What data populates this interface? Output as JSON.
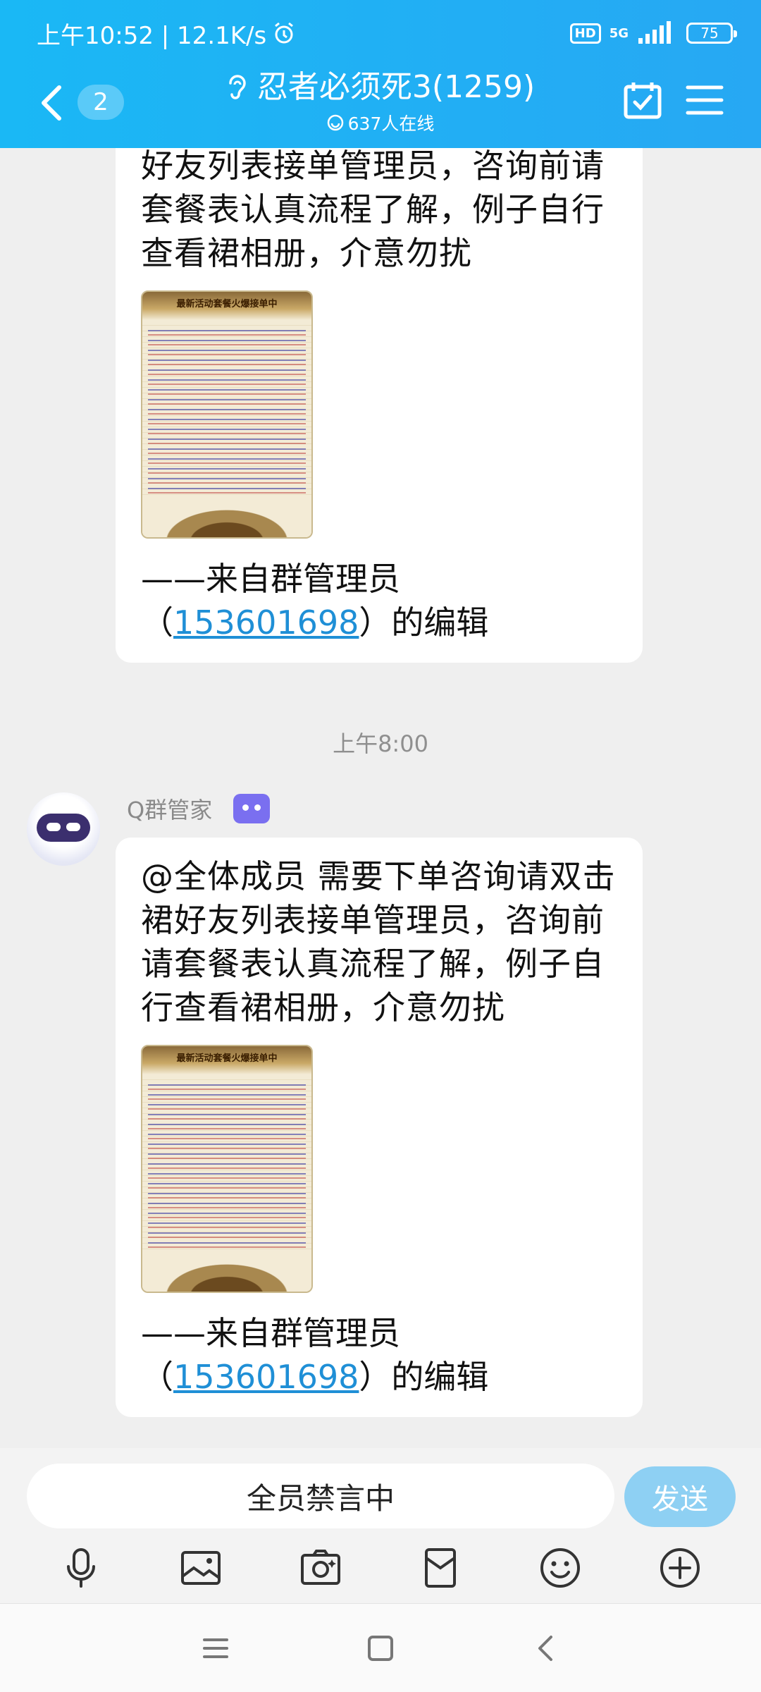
{
  "status_bar": {
    "time": "上午10:52 | 12.1K/s",
    "network": "5G",
    "hd": "HD",
    "battery": "75"
  },
  "header": {
    "unread_count": "2",
    "title": "忍者必须死3(1259)",
    "online": "637人在线"
  },
  "messages": [
    {
      "text": "@不是过 需要下单咨询请双击裙好友列表接单管理员，咨询前请套餐表认真流程了解，例子自行查看裙相册，介意勿扰",
      "image_caption": "最新活动套餐火爆接单中",
      "signature_prefix": "——来自群管理员（",
      "signature_link": "153601698",
      "signature_suffix": "）的编辑"
    },
    {
      "text": "@全体成员 需要下单咨询请双击裙好友列表接单管理员，咨询前请套餐表认真流程了解，例子自行查看裙相册，介意勿扰",
      "image_caption": "最新活动套餐火爆接单中",
      "signature_prefix": "——来自群管理员（",
      "signature_link": "153601698",
      "signature_suffix": "）的编辑"
    }
  ],
  "timestamp": "上午8:00",
  "sender": {
    "name": "Q群管家"
  },
  "input": {
    "muted_text": "全员禁言中",
    "send_label": "发送"
  },
  "toolbar_icons": [
    "microphone-icon",
    "image-icon",
    "camera-icon",
    "red-packet-icon",
    "emoji-icon",
    "plus-icon"
  ],
  "colors": {
    "header": "#1ab8f5",
    "link": "#1f8fd6",
    "send_button": "#8ed0f3"
  }
}
